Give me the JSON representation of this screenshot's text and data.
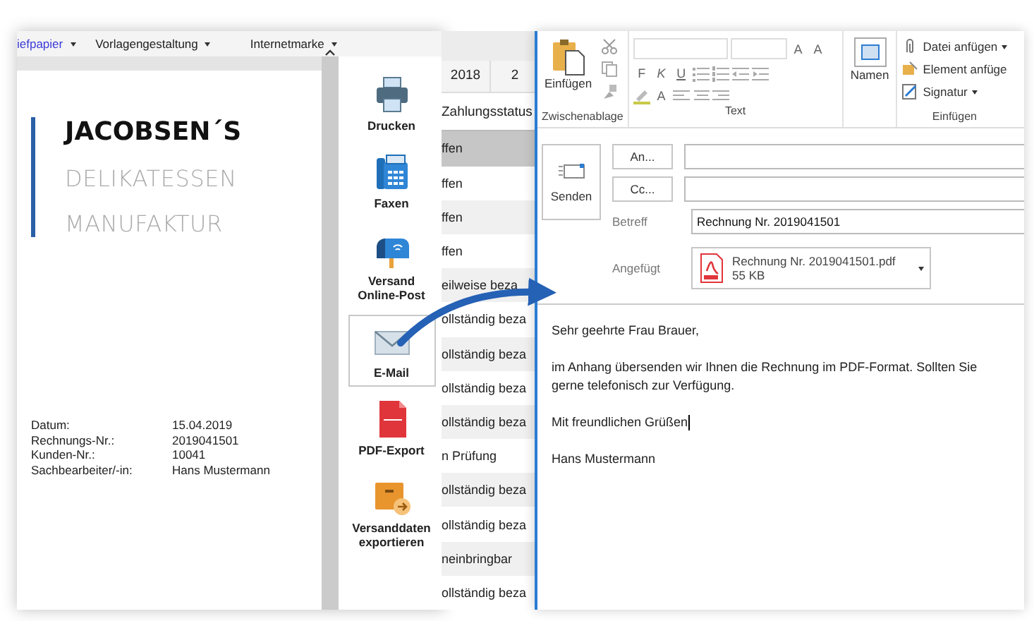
{
  "letter_app": {
    "menu": [
      {
        "label": "iefpapier",
        "selected": true
      },
      {
        "label": "Vorlagengestaltung",
        "selected": false
      },
      {
        "label": "Internetmarke",
        "selected": false
      }
    ],
    "letterhead": {
      "name": "JACOBSEN´S",
      "line_2": "DELIKATESSEN",
      "line_3": "MANUFAKTUR"
    },
    "details": [
      {
        "label": "Datum:",
        "value": "15.04.2019"
      },
      {
        "label": "Rechnungs-Nr.:",
        "value": "2019041501"
      },
      {
        "label": "Kunden-Nr.:",
        "value": "10041"
      },
      {
        "label": "Sachbearbeiter/-in:",
        "value": "Hans Mustermann"
      }
    ],
    "actions": [
      {
        "label": "Drucken",
        "kind": "printer",
        "selected": false
      },
      {
        "label": "Faxen",
        "kind": "fax",
        "selected": false
      },
      {
        "label": "Versand Online-Post",
        "kind": "mailbox",
        "selected": false
      },
      {
        "label": "E-Mail",
        "kind": "envelope",
        "selected": true
      },
      {
        "label": "PDF-Export",
        "kind": "pdf",
        "selected": false
      },
      {
        "label": "Versanddaten exportieren",
        "kind": "package",
        "selected": false
      }
    ]
  },
  "invoice_list": {
    "year_tabs": [
      "2018",
      "2"
    ],
    "column": "Zahlungsstatus",
    "rows": [
      {
        "status": "ffen",
        "selected": true
      },
      {
        "status": "ffen",
        "selected": false
      },
      {
        "status": "ffen",
        "selected": false
      },
      {
        "status": "ffen",
        "selected": false
      },
      {
        "status": "eilweise beza",
        "selected": false
      },
      {
        "status": "ollständig beza",
        "selected": false
      },
      {
        "status": "ollständig beza",
        "selected": false
      },
      {
        "status": "ollständig beza",
        "selected": false
      },
      {
        "status": "ollständig beza",
        "selected": false
      },
      {
        "status": "n Prüfung",
        "selected": false
      },
      {
        "status": "ollständig beza",
        "selected": false
      },
      {
        "status": "ollständig beza",
        "selected": false
      },
      {
        "status": "neinbringbar",
        "selected": false
      },
      {
        "status": "ollständig beza",
        "selected": false
      }
    ]
  },
  "mail": {
    "ribbon": {
      "paste": "Einfügen",
      "clipboard_group": "Zwischenablage",
      "format_buttons": [
        "F",
        "K",
        "U"
      ],
      "font_color": "A",
      "grow_font": "A",
      "shrink_font": "A",
      "text_group": "Text",
      "names": "Namen",
      "insert_items": [
        {
          "label": "Datei anfügen",
          "kind": "attach",
          "dropdown": true
        },
        {
          "label": "Element anfüge",
          "kind": "item",
          "dropdown": false
        },
        {
          "label": "Signatur",
          "kind": "signature",
          "dropdown": true
        }
      ],
      "insert_group": "Einfügen"
    },
    "send": "Senden",
    "recipients": [
      {
        "button": "An..."
      },
      {
        "button": "Cc..."
      }
    ],
    "subject": {
      "label": "Betreff",
      "value": "Rechnung Nr. 2019041501"
    },
    "attachment": {
      "label": "Angefügt",
      "file": "Rechnung Nr. 2019041501.pdf",
      "size": "55 KB"
    },
    "body": [
      [
        "Sehr geehrte Frau Brauer,"
      ],
      [
        "im Anhang übersenden wir Ihnen die Rechnung im PDF-Format. Sollten Sie",
        "gerne telefonisch zur Verfügung."
      ],
      [
        "Mit freundlichen Grüßen"
      ],
      [
        "Hans Mustermann"
      ]
    ]
  }
}
